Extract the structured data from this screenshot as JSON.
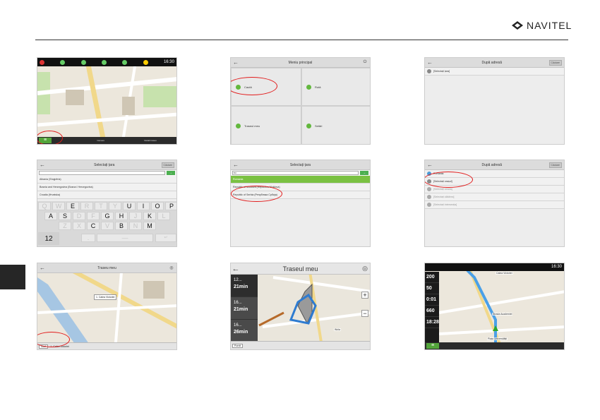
{
  "brand": "NAVITEL",
  "p1": {
    "time": "16:30",
    "bottom_items": [
      "",
      "Camere",
      "Detalii traseu"
    ],
    "menu_icon": "menu-icon",
    "street_labels": [
      "Bulevardul Nicolae Bălcescu",
      "Piața Universității"
    ]
  },
  "p2": {
    "title": "Meniu principal",
    "items": [
      "Caută",
      "Rută",
      "Traseul meu",
      "Setări"
    ]
  },
  "p3": {
    "title": "După adresă",
    "header_btn": "Căutare",
    "row": "[Selectați țara]"
  },
  "p4": {
    "title": "Selectați țara",
    "header_btn": "Căutare",
    "countries": [
      "Albania (Shqipëria)",
      "Bosnia and Herzegovina (Bosna i Hercegovina)",
      "Croatia (Hrvatska)"
    ],
    "row1": [
      "Q",
      "W",
      "E",
      "R",
      "T",
      "Y",
      "U",
      "I",
      "O",
      "P"
    ],
    "row2": [
      "A",
      "S",
      "D",
      "F",
      "G",
      "H",
      "J",
      "K",
      "L"
    ],
    "row3": [
      "Z",
      "X",
      "C",
      "V",
      "B",
      "N",
      "M"
    ],
    "num_key": "12"
  },
  "p5": {
    "title": "Selectați țara",
    "query": "ro",
    "results": [
      "Romania",
      "Republic of Moldova (Republica Moldova)",
      "Republic of Serbia (Република Србија)"
    ]
  },
  "p6": {
    "title": "După adresă",
    "header_btn": "Căutare",
    "rows": [
      "Romania",
      "[Selectați orașul]",
      "[Selectați strada]",
      "[Selectați clădirea]",
      "[Selectați intersecția]"
    ]
  },
  "p7": {
    "title": "Traseu meu",
    "popup": "1. Calea Victoriei",
    "route_btn": "Start",
    "route_info": "1. Calea Victoriei"
  },
  "p8": {
    "title": "Traseul meu",
    "options": [
      {
        "dist": "12...",
        "time": "21min"
      },
      {
        "dist": "16...",
        "time": "21min"
      },
      {
        "dist": "16...",
        "time": "26min"
      }
    ],
    "start_btn": "Pornit",
    "place_label": "Wola"
  },
  "p9": {
    "time": "16:30",
    "speed": "200",
    "limit": "50",
    "elapsed": "0:01",
    "dist": "660",
    "eta": "18:28",
    "streets": [
      "Calea Victoriei",
      "Strada Academiei",
      "Piața Universității"
    ]
  }
}
